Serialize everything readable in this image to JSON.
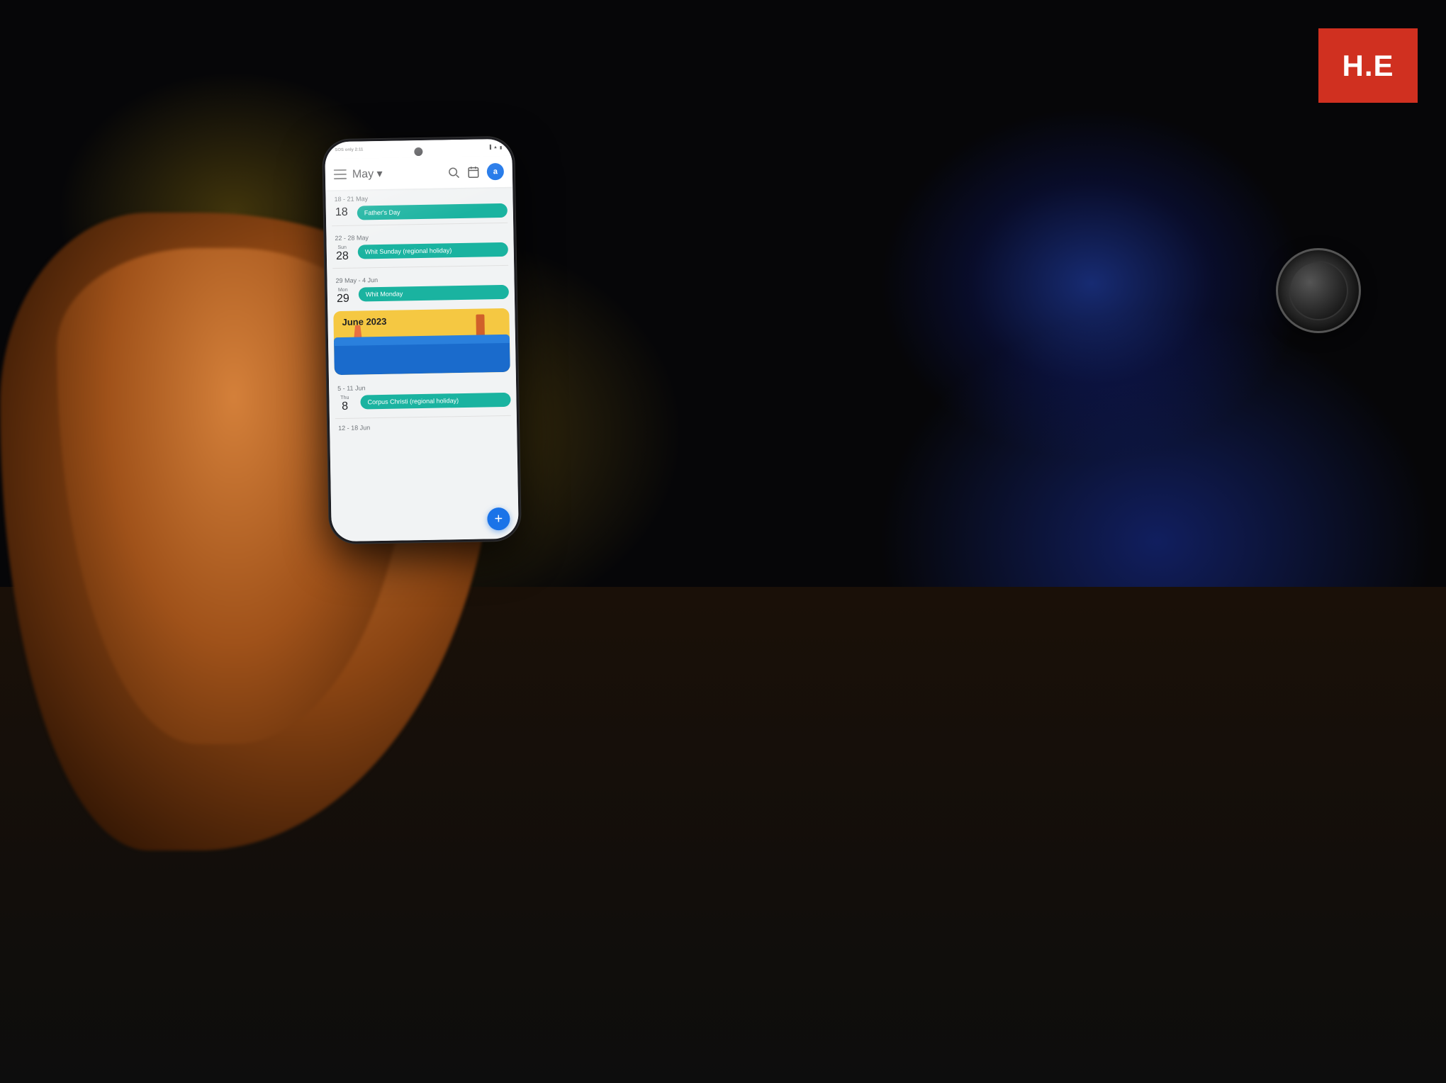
{
  "scene": {
    "background": "dark desk scene"
  },
  "he_badge": {
    "text": "H.E"
  },
  "phone": {
    "status_bar": {
      "left": "SOS only 2:11",
      "right": "battery icons"
    },
    "header": {
      "menu_label": "menu",
      "title": "May",
      "title_dropdown": "▾",
      "avatar_letter": "a"
    },
    "calendar": {
      "weeks": [
        {
          "week_range": "18 - 21 May",
          "date_num": "18",
          "day_label": "",
          "events": [
            {
              "label": "Father's Day",
              "color": "#1ab3a0"
            }
          ]
        },
        {
          "week_range": "22 - 28 May",
          "date_num": "28",
          "day_label": "Sun",
          "events": [
            {
              "label": "Whit Sunday (regional holiday)",
              "color": "#1ab3a0"
            }
          ]
        },
        {
          "week_range": "29 May - 4 Jun",
          "date_num": "29",
          "day_label": "Mon",
          "events": [
            {
              "label": "Whit Monday",
              "color": "#1ab3a0"
            }
          ]
        }
      ],
      "june_banner": {
        "title": "June 2023"
      },
      "june_week": {
        "week_range": "5 - 11 Jun",
        "date_num": "8",
        "day_label": "Thu",
        "events": [
          {
            "label": "Corpus Christi (regional holiday)",
            "color": "#1ab3a0"
          }
        ]
      },
      "next_week_range": "12 - 18 Jun",
      "fab_label": "+"
    }
  }
}
